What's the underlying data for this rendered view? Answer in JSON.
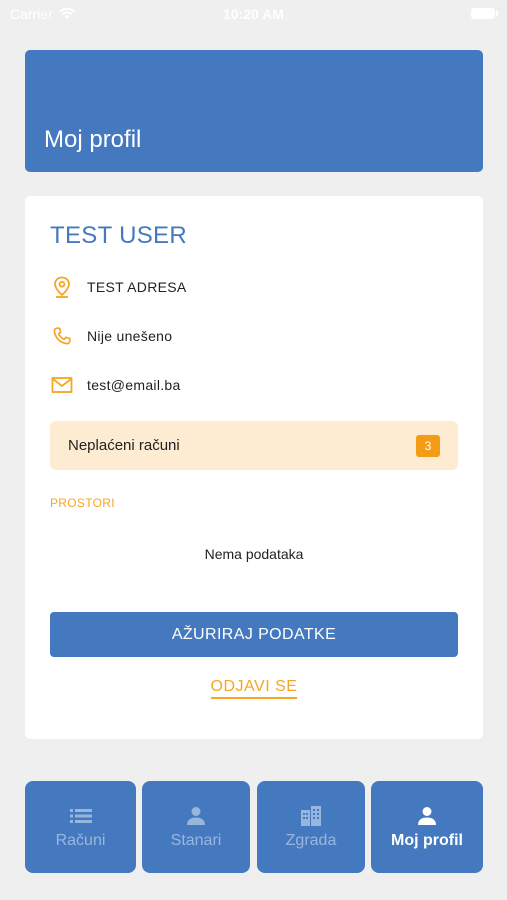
{
  "status_bar": {
    "carrier": "Carrier",
    "time": "10:20 AM"
  },
  "header": {
    "title": "Moj profil",
    "color": "#4479c0"
  },
  "profile": {
    "name": "TEST USER",
    "address": "TEST ADRESA",
    "phone": "Nije unešeno",
    "email": "test@email.ba",
    "icons": [
      "location-pin-icon",
      "phone-icon",
      "mail-icon"
    ]
  },
  "unpaid": {
    "label": "Neplaćeni računi",
    "count": "3"
  },
  "spaces": {
    "section_label": "PROSTORI",
    "empty_text": "Nema podataka"
  },
  "actions": {
    "update_label": "AŽURIRAJ PODATKE",
    "logout_label": "ODJAVI SE"
  },
  "tabs": [
    {
      "label": "Računi",
      "icon": "list-icon",
      "active": false
    },
    {
      "label": "Stanari",
      "icon": "person-icon",
      "active": false
    },
    {
      "label": "Zgrada",
      "icon": "building-icon",
      "active": false
    },
    {
      "label": "Moj profil",
      "icon": "person-icon",
      "active": true
    }
  ],
  "colors": {
    "primary": "#4479c0",
    "accent": "#f5a623",
    "unpaid_background": "#fdecd1",
    "page_background": "#efefef"
  }
}
